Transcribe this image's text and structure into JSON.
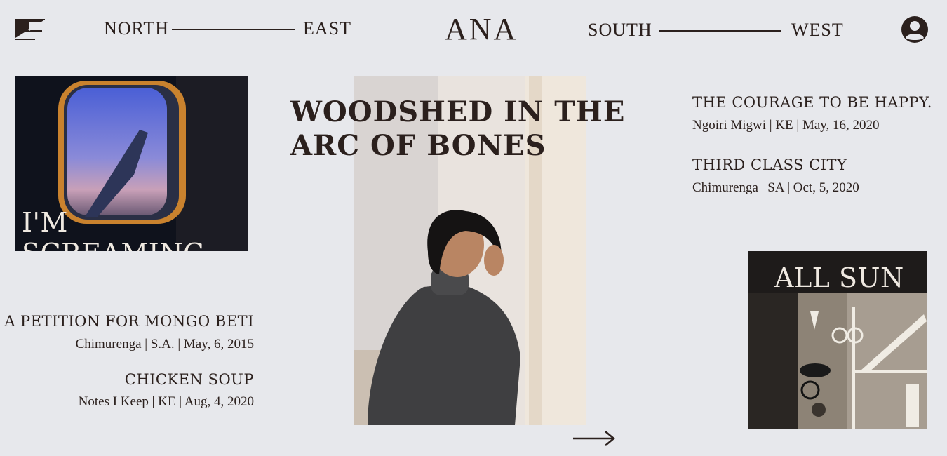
{
  "header": {
    "nav": [
      "NORTH",
      "EAST",
      "SOUTH",
      "WEST"
    ],
    "brand": "ANA"
  },
  "featured_left": {
    "overlay_title": "I'M SCREAMING"
  },
  "featured_center": {
    "title": "WOODSHED IN THE ARC OF BONES"
  },
  "featured_right": {
    "overlay_title": "ALL SUN"
  },
  "left_articles": [
    {
      "title": "A PETITION FOR MONGO BETI",
      "meta": "Chimurenga | S.A. | May, 6, 2015"
    },
    {
      "title": "CHICKEN SOUP",
      "meta": "Notes I Keep | KE | Aug, 4, 2020"
    }
  ],
  "right_articles": [
    {
      "title": "THE COURAGE TO BE HAPPY.",
      "meta": "Ngoiri Migwi | KE | May, 16, 2020"
    },
    {
      "title": "THIRD CLASS CITY",
      "meta": "Chimurenga | SA | Oct, 5, 2020"
    }
  ],
  "icons": {
    "logo": "logo-mark-icon",
    "user": "user-account-icon",
    "next": "arrow-right-icon"
  }
}
